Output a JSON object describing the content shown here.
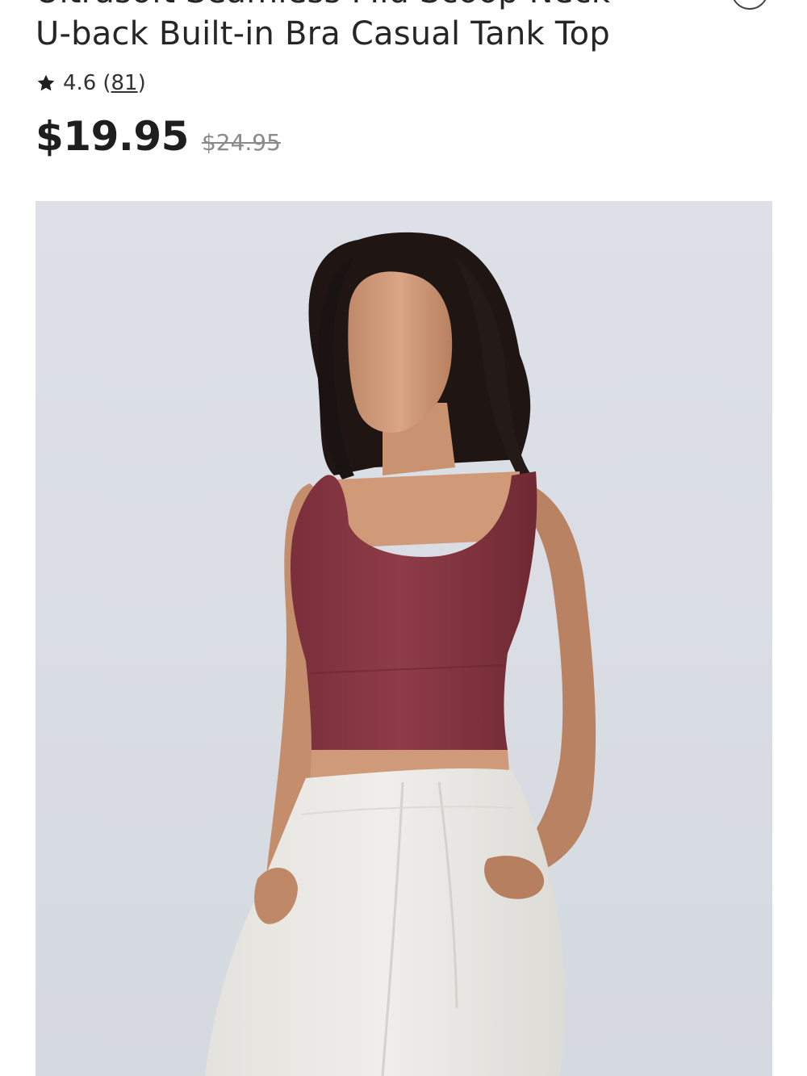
{
  "product": {
    "title_line1": "Ultrasoft Seamless Mid Scoop Neck",
    "title_line2": "U-back Built-in Bra Casual Tank Top",
    "rating": {
      "value": "4.6",
      "count": "81",
      "icon": "star-icon"
    },
    "price": {
      "current": "$19.95",
      "original": "$24.95"
    },
    "wishlist_icon": "heart-icon",
    "image": {
      "description_icon": "product-photo",
      "background_color": "#d9dde4",
      "top_color": "#8b3a45",
      "pants_color": "#ecebe7"
    }
  }
}
